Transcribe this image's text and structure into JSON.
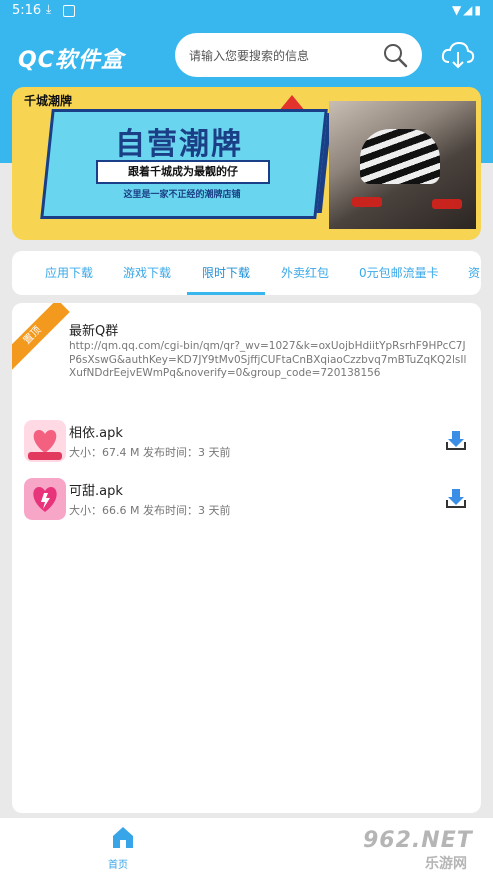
{
  "status_bar": {
    "time": "5:16"
  },
  "header": {
    "app_title": "QC软件盒",
    "search_placeholder": "请输入您要搜索的信息"
  },
  "banner": {
    "corner_title": "千城潮牌",
    "main_text": "自营潮牌",
    "sub_text": "跟着千城成为最靓的仔",
    "small_text": "这里是一家不正经的潮牌店铺"
  },
  "tabs": [
    {
      "label": "应用下载",
      "active": false
    },
    {
      "label": "游戏下载",
      "active": false
    },
    {
      "label": "限时下载",
      "active": true
    },
    {
      "label": "外卖红包",
      "active": false
    },
    {
      "label": "0元包邮流量卡",
      "active": false
    },
    {
      "label": "资",
      "active": false
    }
  ],
  "post": {
    "ribbon": "置顶",
    "title": "最新Q群",
    "link": "http://qm.qq.com/cgi-bin/qm/qr?_wv=1027&k=oxUojbHdiitYpRsrhF9HPcC7JP6sXswG&authKey=KD7JY9tMv0SjffjCUFtaCnBXqiaoCzzbvq7mBTuZqKQ2lsIlXufNDdrEejvEWmPq&noverify=0&group_code=720138156"
  },
  "apps": [
    {
      "name": "相依.apk",
      "meta": "大小：67.4 M  发布时间：3 天前",
      "icon": "xiangyi-app-icon"
    },
    {
      "name": "可甜.apk",
      "meta": "大小：66.6 M  发布时间：3 天前",
      "icon": "ketian-app-icon"
    }
  ],
  "bottom_nav": {
    "home_label": "首页"
  },
  "watermark": {
    "main": "962.NET",
    "sub": "乐游网"
  },
  "colors": {
    "primary": "#38b7ee",
    "banner_bg": "#f7d552",
    "ribbon": "#f39a1e",
    "tab_text": "#3aa8e8"
  }
}
